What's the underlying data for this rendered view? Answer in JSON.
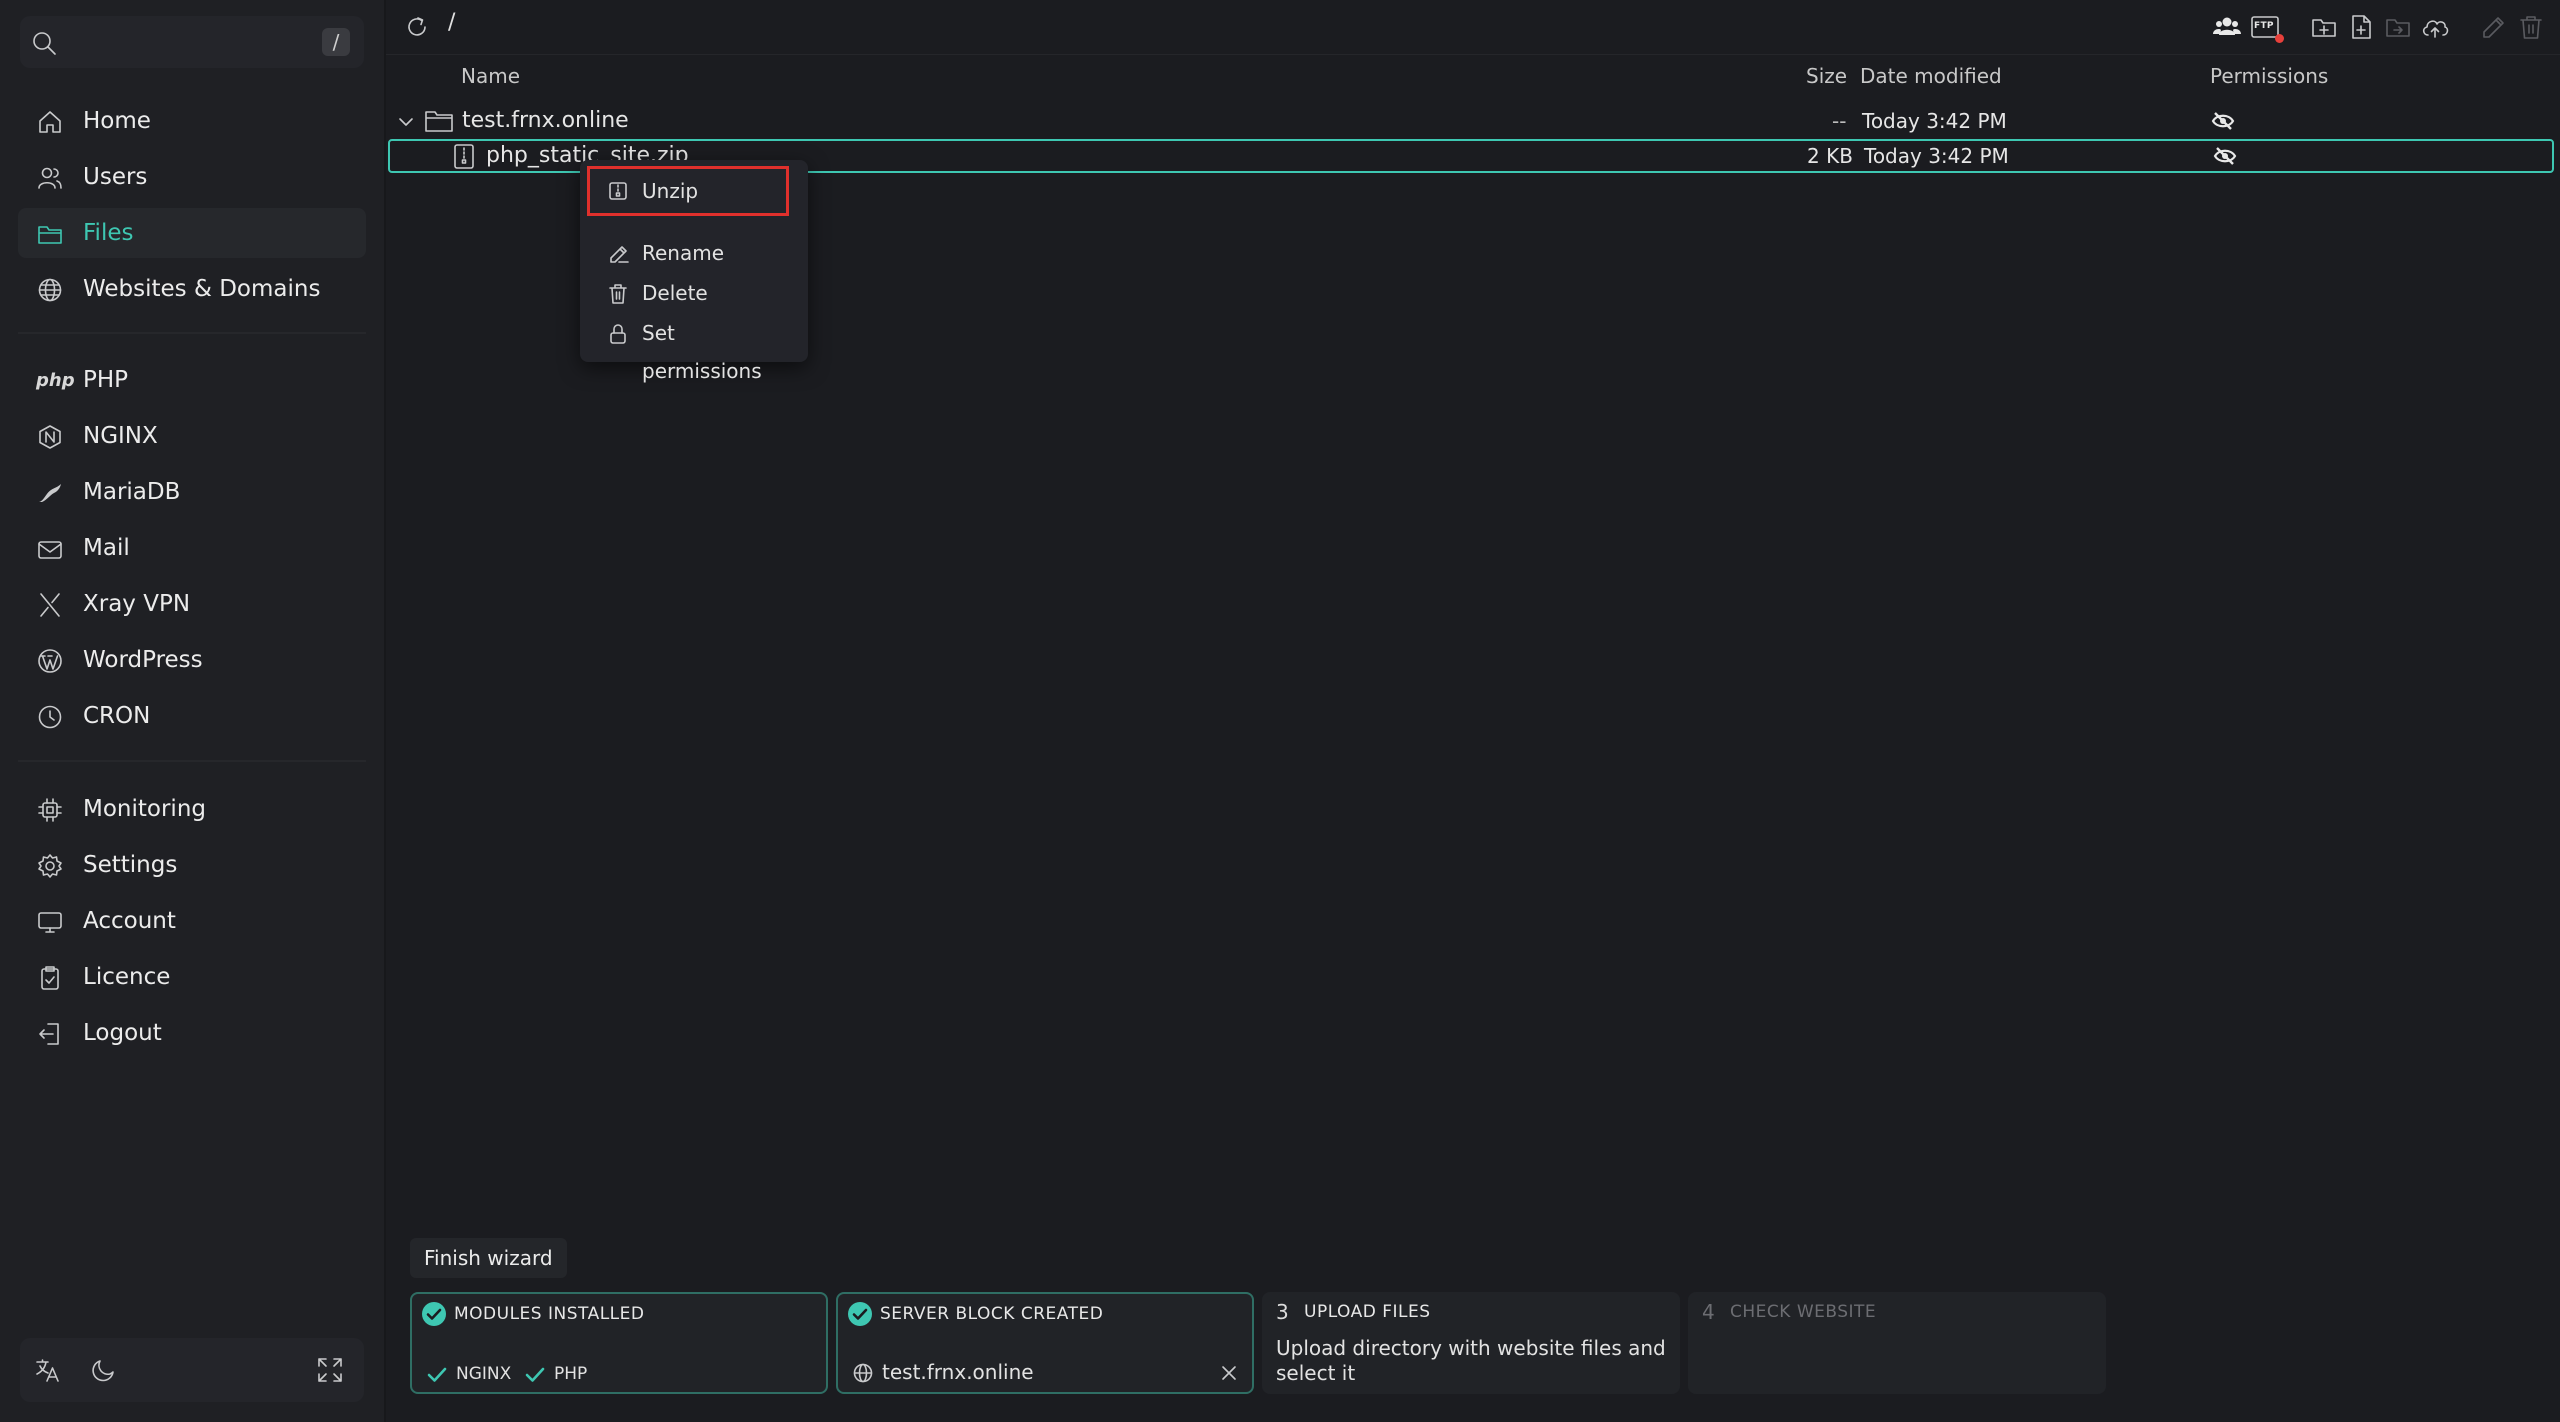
{
  "search": {
    "shortcut": "/"
  },
  "sidebar": {
    "items": [
      {
        "label": "Home",
        "icon": "home-icon"
      },
      {
        "label": "Users",
        "icon": "users-icon"
      },
      {
        "label": "Files",
        "icon": "folder-icon",
        "active": true
      },
      {
        "label": "Websites & Domains",
        "icon": "globe-icon"
      },
      {
        "label": "PHP",
        "icon": "php-icon"
      },
      {
        "label": "NGINX",
        "icon": "nginx-icon"
      },
      {
        "label": "MariaDB",
        "icon": "mariadb-icon"
      },
      {
        "label": "Mail",
        "icon": "mail-icon"
      },
      {
        "label": "Xray VPN",
        "icon": "xray-icon"
      },
      {
        "label": "WordPress",
        "icon": "wordpress-icon"
      },
      {
        "label": "CRON",
        "icon": "clock-icon"
      },
      {
        "label": "Monitoring",
        "icon": "cpu-icon"
      },
      {
        "label": "Settings",
        "icon": "gear-icon"
      },
      {
        "label": "Account",
        "icon": "monitor-icon"
      },
      {
        "label": "Licence",
        "icon": "licence-icon"
      },
      {
        "label": "Logout",
        "icon": "logout-icon"
      }
    ],
    "php_mark": "php"
  },
  "toolbar": {
    "path": "/",
    "ftp_badge": "FTP"
  },
  "table": {
    "headers": {
      "name": "Name",
      "size": "Size",
      "date": "Date modified",
      "permissions": "Permissions"
    },
    "rows": [
      {
        "name": "test.frnx.online",
        "size": "--",
        "date": "Today 3:42 PM",
        "type": "folder"
      },
      {
        "name": "php_static_site.zip",
        "size": "2 KB",
        "date": "Today 3:42 PM",
        "type": "zip"
      }
    ]
  },
  "context_menu": {
    "items": [
      {
        "label": "Unzip",
        "icon": "zip-icon"
      },
      {
        "label": "Rename",
        "icon": "edit-icon"
      },
      {
        "label": "Delete",
        "icon": "trash-icon"
      },
      {
        "label": "Set permissions",
        "icon": "lock-icon"
      }
    ]
  },
  "wizard": {
    "finish_label": "Finish wizard",
    "steps": [
      {
        "title": "MODULES INSTALLED",
        "status": "done",
        "tags": [
          "NGINX",
          "PHP"
        ]
      },
      {
        "title": "SERVER BLOCK CREATED",
        "status": "done",
        "domain": "test.frnx.online"
      },
      {
        "number": "3",
        "title": "UPLOAD FILES",
        "status": "current",
        "description": "Upload directory with website files and select it"
      },
      {
        "number": "4",
        "title": "CHECK WEBSITE",
        "status": "pending"
      }
    ]
  },
  "colors": {
    "accent": "#3ec7b2",
    "background": "#1b1c20",
    "sidebar": "#1f2024",
    "highlight_box": "#e0302c"
  }
}
